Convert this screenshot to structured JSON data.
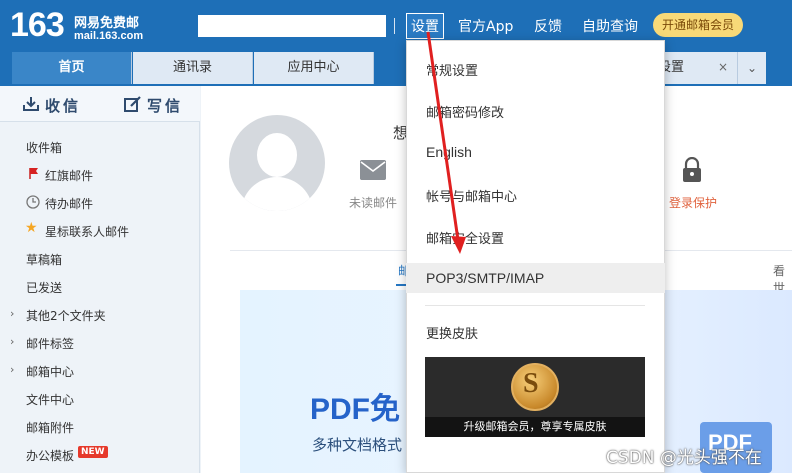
{
  "header": {
    "logo_number": "163",
    "logo_name": "网易免费邮",
    "logo_domain": "mail.163.com",
    "nav": [
      "设置",
      "官方App",
      "反馈",
      "自助查询"
    ],
    "vip_button": "开通邮箱会员"
  },
  "tabs": {
    "home": "首页",
    "contacts": "通讯录",
    "apps": "应用中心",
    "settings_partial": "设置",
    "close": "×",
    "more": "⌄"
  },
  "sidebar": {
    "receive": "收信",
    "compose": "写信",
    "items": [
      "收件箱",
      "红旗邮件",
      "待办邮件",
      "星标联系人邮件",
      "草稿箱",
      "已发送",
      "其他2个文件夹",
      "邮件标签",
      "邮箱中心",
      "文件中心",
      "邮箱附件",
      "办公模板"
    ],
    "new_badge": "NEW"
  },
  "main": {
    "greeting": "想",
    "unread_label": "未读邮件",
    "login_protect_label": "登录保护",
    "panel_tab_first": "邮",
    "panel_tab_right": "看世",
    "banner_title": "PDF免",
    "banner_subtitle": "多种文档格式",
    "pdf_icon_label": "PDF"
  },
  "dropdown": {
    "items": [
      "常规设置",
      "邮箱密码修改",
      "English",
      "帐号与邮箱中心",
      "邮箱安全设置",
      "POP3/SMTP/IMAP",
      "更换皮肤"
    ],
    "skin_caption": "升级邮箱会员，尊享专属皮肤",
    "coin_symbol": "S"
  },
  "watermark": "CSDN @光头强不在",
  "colors": {
    "header_blue": "#1e6fb7",
    "vip_gold": "#f8d978",
    "annotation_red": "#e02020",
    "highlight_grey": "#eeeeee"
  }
}
